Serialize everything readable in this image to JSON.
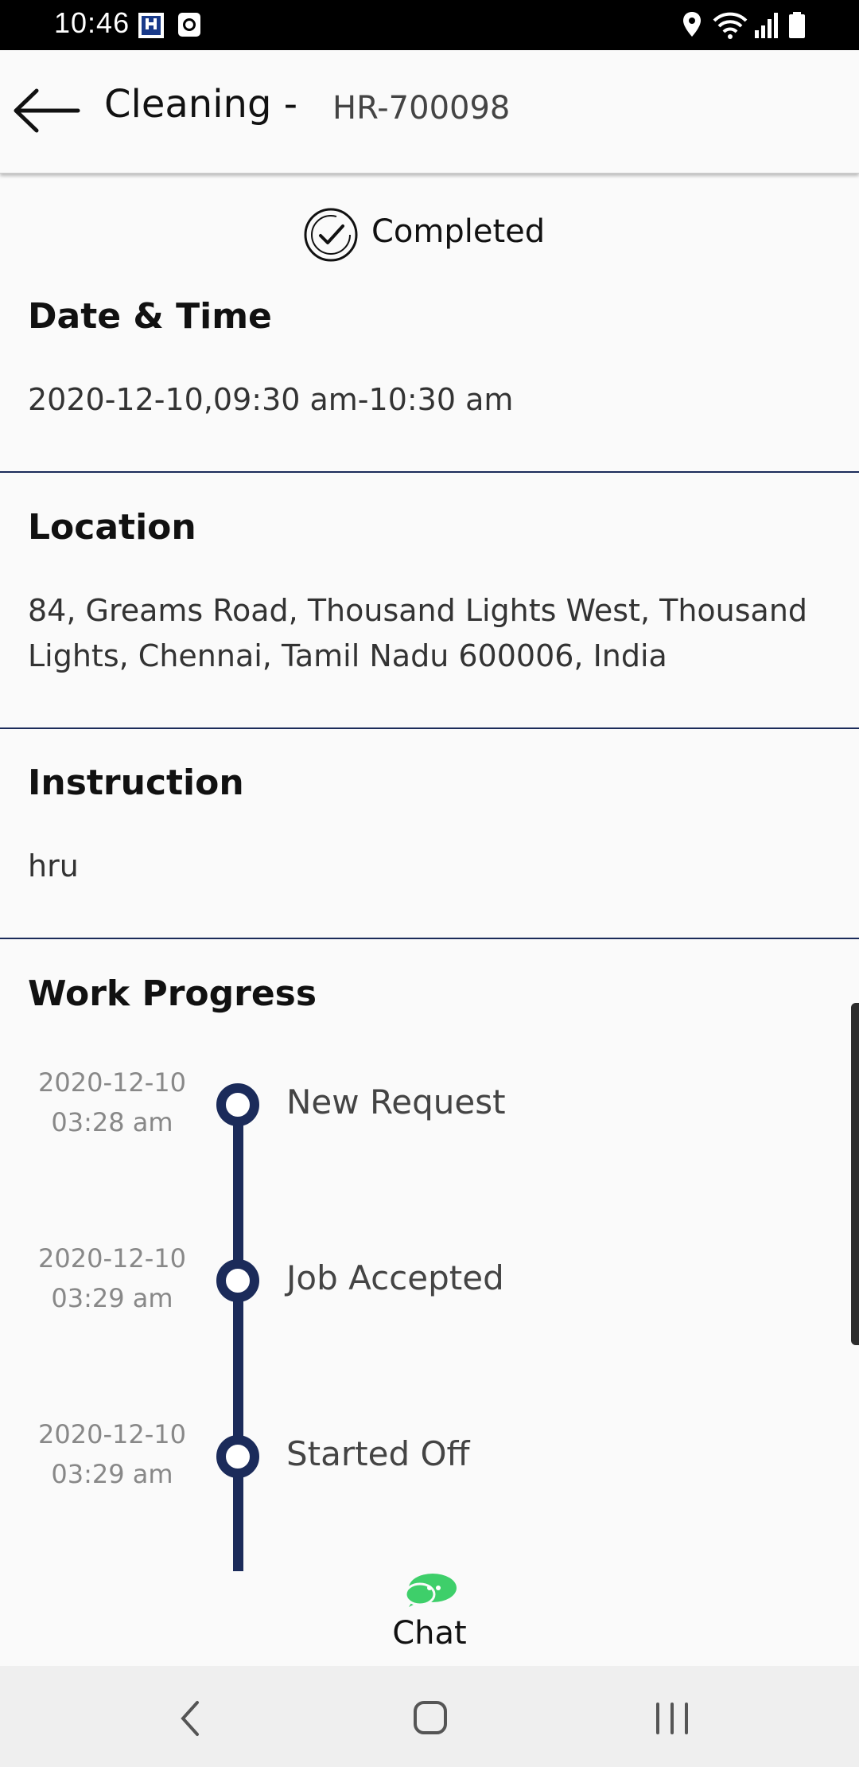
{
  "statusbar": {
    "time": "10:46"
  },
  "appbar": {
    "title": "Cleaning -",
    "code": "HR-700098"
  },
  "status": {
    "label": "Completed"
  },
  "date_time": {
    "title": "Date & Time",
    "value": "2020-12-10,09:30 am-10:30 am"
  },
  "location": {
    "title": "Location",
    "line1": "84, Greams Road, Thousand Lights West, Thousand",
    "line2": "Lights, Chennai, Tamil Nadu 600006, India"
  },
  "instruction": {
    "title": "Instruction",
    "value": "hru"
  },
  "work_progress": {
    "title": "Work Progress",
    "steps": [
      {
        "date": "2020-12-10",
        "time": "03:28 am",
        "label": "New Request"
      },
      {
        "date": "2020-12-10",
        "time": "03:29 am",
        "label": "Job Accepted"
      },
      {
        "date": "2020-12-10",
        "time": "03:29 am",
        "label": "Started Off"
      }
    ]
  },
  "chat": {
    "label": "Chat"
  },
  "colors": {
    "accent": "#1b2b5a",
    "chat": "#3ecf6a"
  }
}
